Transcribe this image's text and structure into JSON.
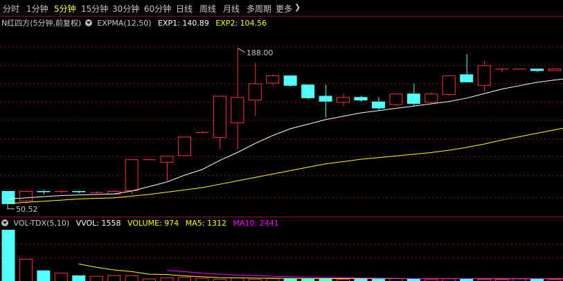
{
  "tabs": [
    {
      "label": "分时",
      "active": false
    },
    {
      "label": "1分钟",
      "active": false
    },
    {
      "label": "5分钟",
      "active": true
    },
    {
      "label": "15分钟",
      "active": false
    },
    {
      "label": "30分钟",
      "active": false
    },
    {
      "label": "60分钟",
      "active": false
    },
    {
      "label": "日线",
      "active": false
    },
    {
      "label": "周线",
      "active": false
    },
    {
      "label": "月线",
      "active": false
    },
    {
      "label": "多周期",
      "active": false
    },
    {
      "label": "更多",
      "active": false
    }
  ],
  "more_icon": "chevron-right-icon",
  "main_legend": {
    "stock": "N红四方(5分钟,前复权)",
    "indicator": "EXPMA(12,50)",
    "exp1": "EXP1: 140.89",
    "exp2": "EXP2: 104.56"
  },
  "vol_legend": {
    "indicator": "VOL-TDX(5,10)",
    "vvol": "VVOL: 1558",
    "volume": "VOLUME: 974",
    "ma5": "MA5: 1312",
    "ma10": "MA10: 2441"
  },
  "annotations": {
    "high": "188.00",
    "low": "50.52"
  },
  "colors": {
    "up": "#ff3232",
    "down": "#54ffff",
    "exp1": "#ffffff",
    "exp2": "#ffff00",
    "ma5": "#ffff00",
    "ma10": "#ff00ff",
    "grid": "#8a1010",
    "active_tab": "#ffff33"
  },
  "chart_data": {
    "type": "candlestick",
    "price_range": [
      40,
      205
    ],
    "candles": [
      {
        "o": 62,
        "h": 62,
        "l": 50.52,
        "c": 50.5
      },
      {
        "o": 53,
        "h": 63,
        "l": 51,
        "c": 62
      },
      {
        "o": 62,
        "h": 63,
        "l": 59,
        "c": 61
      },
      {
        "o": 62,
        "h": 63,
        "l": 60,
        "c": 62
      },
      {
        "o": 62,
        "h": 62,
        "l": 60,
        "c": 61
      },
      {
        "o": 61,
        "h": 62,
        "l": 60,
        "c": 61
      },
      {
        "o": 59,
        "h": 63,
        "l": 59,
        "c": 62
      },
      {
        "o": 62,
        "h": 90,
        "l": 59,
        "c": 90
      },
      {
        "o": 90,
        "h": 90,
        "l": 89,
        "c": 90
      },
      {
        "o": 87,
        "h": 93,
        "l": 70,
        "c": 93
      },
      {
        "o": 93,
        "h": 110,
        "l": 93,
        "c": 110
      },
      {
        "o": 114,
        "h": 115,
        "l": 113,
        "c": 114
      },
      {
        "o": 109,
        "h": 146,
        "l": 99,
        "c": 146
      },
      {
        "o": 122,
        "h": 188,
        "l": 99,
        "c": 145
      },
      {
        "o": 142,
        "h": 175,
        "l": 128,
        "c": 157
      },
      {
        "o": 157,
        "h": 165,
        "l": 155,
        "c": 164
      },
      {
        "o": 164,
        "h": 164,
        "l": 154,
        "c": 155
      },
      {
        "o": 156,
        "h": 156,
        "l": 143,
        "c": 144
      },
      {
        "o": 146,
        "h": 156,
        "l": 127,
        "c": 141
      },
      {
        "o": 140,
        "h": 148,
        "l": 137,
        "c": 145
      },
      {
        "o": 145,
        "h": 146,
        "l": 141,
        "c": 142
      },
      {
        "o": 141,
        "h": 145,
        "l": 133,
        "c": 135
      },
      {
        "o": 138,
        "h": 148,
        "l": 137,
        "c": 148
      },
      {
        "o": 148,
        "h": 157,
        "l": 137,
        "c": 139
      },
      {
        "o": 140,
        "h": 149,
        "l": 139,
        "c": 148
      },
      {
        "o": 147,
        "h": 164,
        "l": 146,
        "c": 164
      },
      {
        "o": 165,
        "h": 183,
        "l": 160,
        "c": 158
      },
      {
        "o": 155,
        "h": 177,
        "l": 150,
        "c": 173
      },
      {
        "o": 170,
        "h": 170,
        "l": 167,
        "c": 170
      },
      {
        "o": 170,
        "h": 170,
        "l": 169,
        "c": 170
      },
      {
        "o": 170,
        "h": 170,
        "l": 167,
        "c": 168
      },
      {
        "o": 168,
        "h": 170,
        "l": 168,
        "c": 170
      },
      {
        "o": 170,
        "h": 171,
        "l": 170,
        "c": 171
      }
    ],
    "exp1": [
      55,
      56,
      57,
      58,
      58.5,
      59,
      59.5,
      62,
      66,
      70,
      76,
      81,
      89,
      96,
      104,
      111,
      117,
      121,
      125,
      128,
      131,
      133,
      135,
      137,
      139,
      141,
      144,
      148,
      152,
      155,
      158,
      160,
      162
    ],
    "exp2": [
      51,
      52,
      53,
      54,
      55,
      55.5,
      56,
      57.5,
      59,
      61,
      63,
      65,
      68,
      71,
      74,
      77,
      80,
      83,
      86,
      88,
      90,
      91.5,
      93,
      94.5,
      96,
      98,
      100.5,
      103.5,
      107,
      110,
      113,
      116,
      119
    ],
    "volume_range": [
      0,
      3000
    ],
    "volumes": [
      3000,
      1300,
      620,
      480,
      330,
      300,
      340,
      330,
      140,
      200,
      250,
      180,
      130,
      200,
      120,
      160,
      140,
      130,
      160,
      120,
      150,
      130,
      160,
      130,
      110,
      150,
      140,
      120,
      110,
      170,
      140,
      120,
      110
    ],
    "ma5": [
      null,
      null,
      null,
      null,
      1000,
      800,
      650,
      550,
      400,
      380,
      300,
      250,
      200,
      180,
      170,
      160,
      150,
      140,
      140,
      140,
      140,
      140,
      140,
      140,
      140,
      140,
      140,
      135,
      130,
      130,
      130,
      130,
      130
    ],
    "ma10": [
      null,
      null,
      null,
      null,
      null,
      null,
      null,
      null,
      null,
      620,
      550,
      450,
      400,
      350,
      320,
      280,
      250,
      220,
      200,
      180,
      170,
      160,
      150,
      140,
      140,
      140,
      140,
      140,
      135,
      135,
      135,
      135,
      135
    ]
  }
}
